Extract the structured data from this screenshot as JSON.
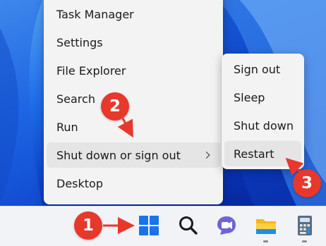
{
  "winx_menu": {
    "items": [
      {
        "label": "Task Manager"
      },
      {
        "label": "Settings"
      },
      {
        "label": "File Explorer"
      },
      {
        "label": "Search"
      },
      {
        "label": "Run"
      },
      {
        "label": "Shut down or sign out",
        "has_submenu": true,
        "highlighted": true
      },
      {
        "label": "Desktop"
      }
    ]
  },
  "shutdown_submenu": {
    "items": [
      {
        "label": "Sign out"
      },
      {
        "label": "Sleep"
      },
      {
        "label": "Shut down"
      },
      {
        "label": "Restart",
        "highlighted": true
      }
    ]
  },
  "taskbar": {
    "icons": [
      "windows-start-icon",
      "search-icon",
      "teams-chat-icon",
      "file-explorer-icon",
      "calculator-icon"
    ]
  },
  "callouts": [
    {
      "number": "1",
      "points_to": "windows-start-icon"
    },
    {
      "number": "2",
      "points_to": "Shut down or sign out"
    },
    {
      "number": "3",
      "points_to": "Restart"
    }
  ],
  "colors": {
    "callout": "#e8372b",
    "menu_bg": "#f3f3f3",
    "highlight": "#e5e5e5",
    "taskbar_bg": "#f2f3f7",
    "windows_blue": "#1a73e8"
  }
}
